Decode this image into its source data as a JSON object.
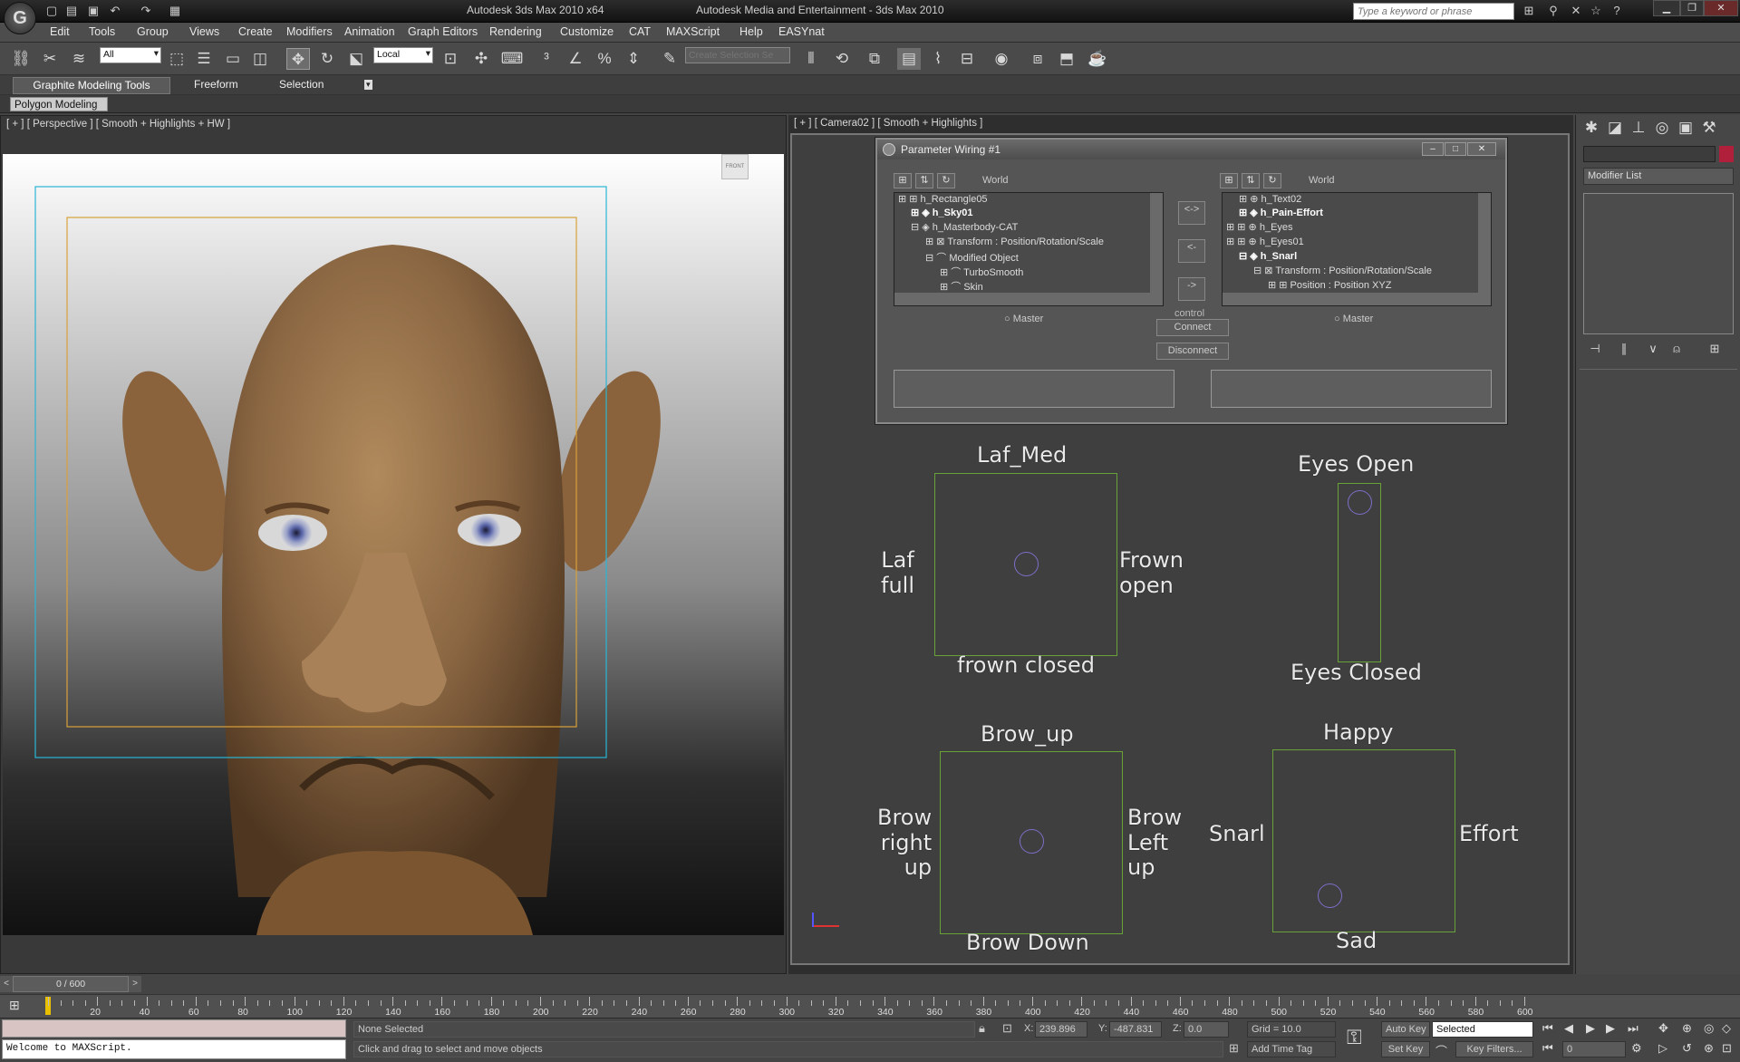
{
  "app": {
    "title": "Autodesk 3ds Max  2010 x64",
    "title2": "Autodesk Media and Entertainment - 3ds Max 2010",
    "logo": "G",
    "search_placeholder": "Type a keyword or phrase"
  },
  "menu": [
    "Edit",
    "Tools",
    "Group",
    "Views",
    "Create",
    "Modifiers",
    "Animation",
    "Graph Editors",
    "Rendering",
    "Customize",
    "CAT",
    "MAXScript",
    "Help",
    "EASYnat"
  ],
  "toolbar": {
    "filter_value": "All",
    "coord_value": "Local",
    "selection_set_placeholder": "Create Selection Se"
  },
  "ribbon": {
    "tabs": [
      "Graphite Modeling Tools",
      "Freeform",
      "Selection"
    ],
    "panel": "Polygon Modeling"
  },
  "viewport_left": {
    "label": "[ + ] [ Perspective ] [ Smooth + Highlights + HW ]",
    "viewcube": "FRONT"
  },
  "viewport_right": {
    "label": "[ + ] [ Camera02 ] [ Smooth + Highlights ]",
    "controls": {
      "laf_med": "Laf_Med",
      "laf_full": "Laf\nfull",
      "frown_open": "Frown\nopen",
      "frown_closed": "frown closed",
      "eyes_open": "Eyes Open",
      "eyes_closed": "Eyes Closed",
      "brow_up": "Brow_up",
      "brow_right_up": "Brow\nright\nup",
      "brow_left_up": "Brow\nLeft\nup",
      "brow_down": "Brow Down",
      "happy": "Happy",
      "snarl": "Snarl",
      "effort": "Effort",
      "sad": "Sad"
    }
  },
  "dialog": {
    "title": "Parameter Wiring #1",
    "left_world": "World",
    "right_world": "World",
    "left_tree": [
      {
        "text": "h_Rectangle05",
        "bold": false
      },
      {
        "text": "h_Sky01",
        "bold": true
      },
      {
        "text": "h_Masterbody-CAT",
        "bold": false
      },
      {
        "text": "Transform : Position/Rotation/Scale",
        "bold": false
      },
      {
        "text": "Modified Object",
        "bold": false
      },
      {
        "text": "TurboSmooth",
        "bold": false
      },
      {
        "text": "Skin",
        "bold": false
      }
    ],
    "right_tree": [
      {
        "text": "h_Text02",
        "bold": false
      },
      {
        "text": "h_Pain-Effort",
        "bold": true
      },
      {
        "text": "h_Eyes",
        "bold": false
      },
      {
        "text": "h_Eyes01",
        "bold": false
      },
      {
        "text": "h_Snarl",
        "bold": true
      },
      {
        "text": "Transform : Position/Rotation/Scale",
        "bold": false
      },
      {
        "text": "Position : Position XYZ",
        "bold": false
      }
    ],
    "master_left": "Master",
    "master_right": "Master",
    "control_label": "control",
    "connect": "Connect",
    "disconnect": "Disconnect"
  },
  "command_panel": {
    "modifier_list": "Modifier List",
    "accent_color": "#b0203a"
  },
  "timeline": {
    "frame": "0 / 600",
    "ticks": [
      20,
      40,
      60,
      80,
      100,
      120,
      140,
      160,
      180,
      200,
      220,
      240,
      260,
      280,
      300,
      320,
      340,
      360,
      380,
      400,
      420,
      440,
      460,
      480,
      500,
      520,
      540,
      560,
      580,
      600
    ]
  },
  "status": {
    "maxscript": "Welcome to MAXScript.",
    "selection": "None Selected",
    "prompt": "Click and drag to select and move objects",
    "x_label": "X:",
    "x_value": "239.896",
    "y_label": "Y:",
    "y_value": "-487.831",
    "z_label": "Z:",
    "z_value": "0.0",
    "grid": "Grid = 10.0",
    "add_time_tag": "Add Time Tag",
    "auto_key": "Auto Key",
    "set_key": "Set Key",
    "key_mode": "Selected",
    "key_filters": "Key Filters...",
    "frame_value": "0"
  }
}
